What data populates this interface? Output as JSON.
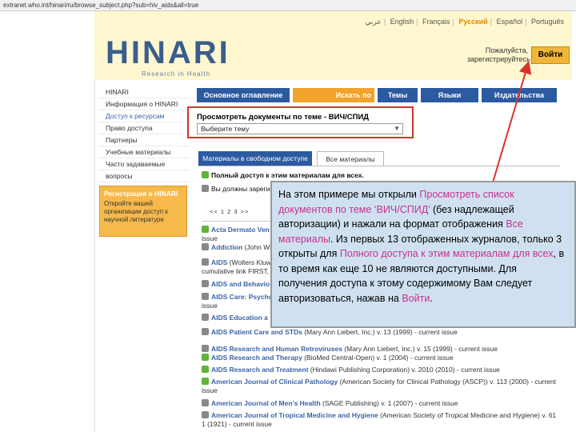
{
  "browser": {
    "url": "extranet.who.int/hinari/ru/browse_subject.php?sub=hiv_aids&all=true"
  },
  "header": {
    "languages": [
      "عربي",
      "English",
      "Français",
      "Русский",
      "Español",
      "Português"
    ],
    "selected_language": "Русский",
    "logo_text": "HINARI",
    "logo_tagline": "Research in Health",
    "login_message": "Пожалуйста, зарегистрируйтесь",
    "login_button": "Войти"
  },
  "sidebar": {
    "items": [
      "HINARI",
      "Информация о HINARI",
      "Доступ к ресурсам",
      "Право доступа",
      "Партнеры",
      "Учебные материалы",
      "Часто задаваемые",
      "вопросы"
    ],
    "register_title": "Регистрация в HINARI",
    "register_text": "Откройте вашей организации доступ к научной литературе"
  },
  "tabs": [
    "Основное оглавление",
    "Искать по",
    "Темы",
    "Языки",
    "Издательства"
  ],
  "browse": {
    "title": "Просмотреть документы по теме - ВИЧ/СПИД",
    "select_value": "Выберите тему"
  },
  "content_tabs": [
    "Материалы в свободном доступе",
    "Все материалы"
  ],
  "legend": {
    "full_access": "Полный доступ к этим материалам для всех.",
    "login_required": "Вы должны зарегистрироваться"
  },
  "pager": "<< 1 2 3 >>",
  "journals": [
    {
      "access": "open",
      "name": "Acta Dermato Ven",
      "rest": "",
      "cont": "issue"
    },
    {
      "access": "closed",
      "name": "Addiction",
      "rest": " (John Wil",
      "cont": ""
    },
    {
      "access": "closed",
      "name": "AIDS",
      "rest": " (Wolters Kluw",
      "cont": "cumulative link FIRST, ("
    },
    {
      "access": "closed",
      "name": "AIDS and Behavio",
      "rest": "",
      "cont": ""
    },
    {
      "access": "closed",
      "name": "AIDS Care: Psycho",
      "rest": "",
      "cont": "issue"
    },
    {
      "access": "closed",
      "name": "AIDS Education a",
      "rest": "",
      "cont": ""
    },
    {
      "access": "closed",
      "name": "AIDS Patient Care and STDs",
      "rest": " (Mary Ann Liebert, Inc.) v. 13 (1999) - current issue",
      "cont": ""
    },
    {
      "access": "closed",
      "name": "AIDS Research and Human Retroviruses",
      "rest": " (Mary Ann Liebert, Inc.) v. 15 (1999) - current issue",
      "cont": ""
    },
    {
      "access": "open",
      "name": "AIDS Research and Therapy",
      "rest": " (BioMed Central-Open) v. 1 (2004) - current issue",
      "cont": ""
    },
    {
      "access": "open",
      "name": "AIDS Research and Treatment",
      "rest": " (Hindawi Publishing Corporation) v. 2010 (2010) - current issue",
      "cont": ""
    },
    {
      "access": "open",
      "name": "American Journal of Clinical Pathology",
      "rest": " (American Society for Clinical Pathology (ASCP)) v. 113 (2000) - current",
      "cont": "issue"
    },
    {
      "access": "closed",
      "name": "American Journal of Men's Health",
      "rest": " (SAGE Publishing) v. 1 (2007) - current issue",
      "cont": ""
    },
    {
      "access": "closed",
      "name": "American Journal of Tropical Medicine and Hygiene",
      "rest": " (American Society of Tropical Medicine and Hygiene) v. 61",
      "cont": "1 (1921) - current issue"
    }
  ],
  "callout": {
    "parts": [
      {
        "text": "На этом примере мы открыли ",
        "hl": false
      },
      {
        "text": "Просмотреть список документов по теме ‘ВИЧ/СПИД’",
        "hl": true
      },
      {
        "text": " (без надлежащей авторизации) и нажали на формат отображения ",
        "hl": false
      },
      {
        "text": "Все материалы",
        "hl": true
      },
      {
        "text": ". Из первых 13 отображенных журналов, только 3 открыты для ",
        "hl": false
      },
      {
        "text": "Полного доступа к этим материалам для всех",
        "hl": true
      },
      {
        "text": ", в то время как еще 10 не являются доступными. Для получения доступа к этому содержимому Вам следует авторизоваться, нажав на ",
        "hl": false
      },
      {
        "text": "Войти",
        "hl": true
      },
      {
        "text": ".",
        "hl": false
      }
    ]
  },
  "colors": {
    "nav_blue": "#2c5aa0",
    "tab_active": "#f1a32c",
    "header_bg": "#fff7cf",
    "open_green": "#5fb33a",
    "highlight": "#c8308f",
    "annotation_red": "#d9322b"
  }
}
